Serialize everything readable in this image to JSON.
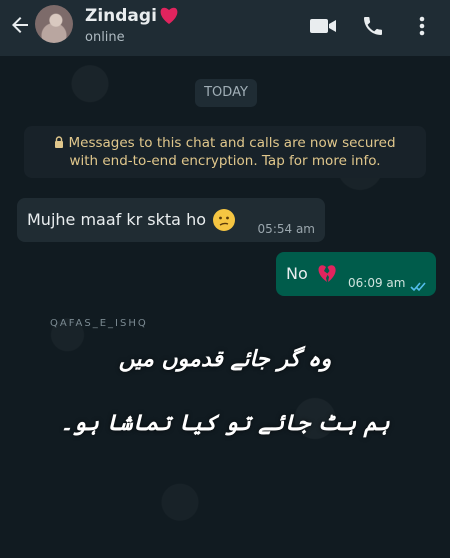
{
  "header": {
    "contact_name": "Zindagi",
    "status": "online",
    "icons": [
      "back-arrow-icon",
      "avatar",
      "red-heart-icon",
      "video-call-icon",
      "phone-call-icon",
      "more-options-icon"
    ]
  },
  "chat": {
    "date_label": "TODAY",
    "notice": {
      "line1": "Messages to this chat and calls are now secured",
      "line2": "with end-to-end encryption. Tap for more info."
    },
    "messages": [
      {
        "direction": "incoming",
        "text": "Mujhe maaf kr skta ho",
        "emoji": "confused-face",
        "time": "05:54 am"
      },
      {
        "direction": "outgoing",
        "text": "No",
        "emoji": "broken-heart",
        "time": "06:09 am",
        "status": "read"
      }
    ]
  },
  "overlay": {
    "watermark": "QAFAS_E_ISHQ",
    "poetry_line1": "وہ گر جائے قدموں میں",
    "poetry_line2": "ہم ہٹ جائے تو کیا تماشا ہو۔"
  },
  "colors": {
    "header_bg": "#1f2c34",
    "chat_bg": "#111b21",
    "incoming_bubble": "#202c33",
    "outgoing_bubble": "#005c4b",
    "notice_text": "#e0c78c",
    "read_ticks": "#53bdeb"
  }
}
